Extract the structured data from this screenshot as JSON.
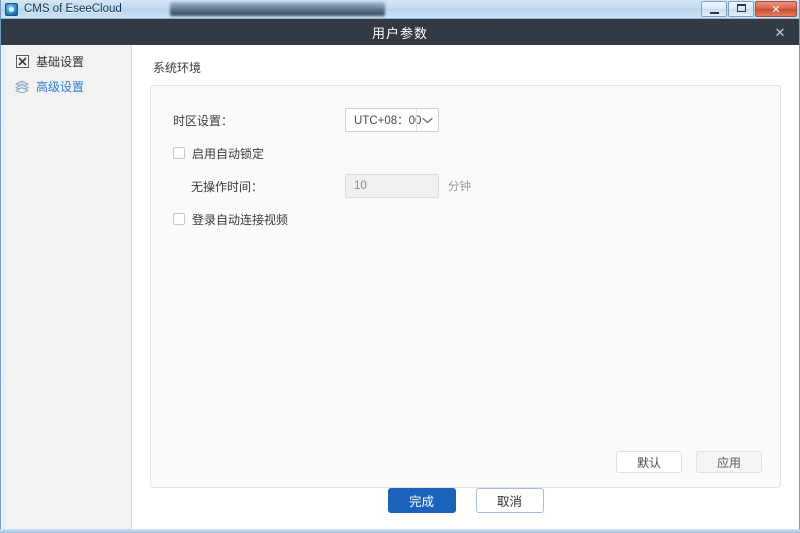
{
  "window": {
    "app_title": "CMS of EseeCloud",
    "app_icon": "app-logo-icon",
    "minimize_label": "",
    "maximize_label": "",
    "close_label": "✕"
  },
  "dialog": {
    "title": "用户参数",
    "close_glyph": "✕"
  },
  "sidebar": {
    "items": [
      {
        "label": "基础设置",
        "icon": "basic-settings-icon",
        "active": false
      },
      {
        "label": "高级设置",
        "icon": "advanced-settings-icon",
        "active": true
      }
    ]
  },
  "content": {
    "section_title": "系统环境",
    "timezone": {
      "label": "时区设置：",
      "value": "UTC+08：00",
      "arrow_icon": "chevron-down-icon"
    },
    "auto_lock": {
      "label": "启用自动锁定",
      "checked": false
    },
    "idle_time": {
      "label": "无操作时间：",
      "value": "10",
      "placeholder": "10",
      "unit": "分钟"
    },
    "auto_connect": {
      "label": "登录自动连接视频",
      "checked": false
    },
    "card_buttons": {
      "default_label": "默认",
      "apply_label": "应用"
    }
  },
  "footer": {
    "confirm_label": "完成",
    "cancel_label": "取消"
  },
  "colors": {
    "accent": "#1b62bd",
    "header_bar": "#333a45",
    "sidebar_active": "#2f7fd0",
    "titlebar_gradient_top": "#d6e6f5",
    "close_button_red": "#c64a30"
  }
}
